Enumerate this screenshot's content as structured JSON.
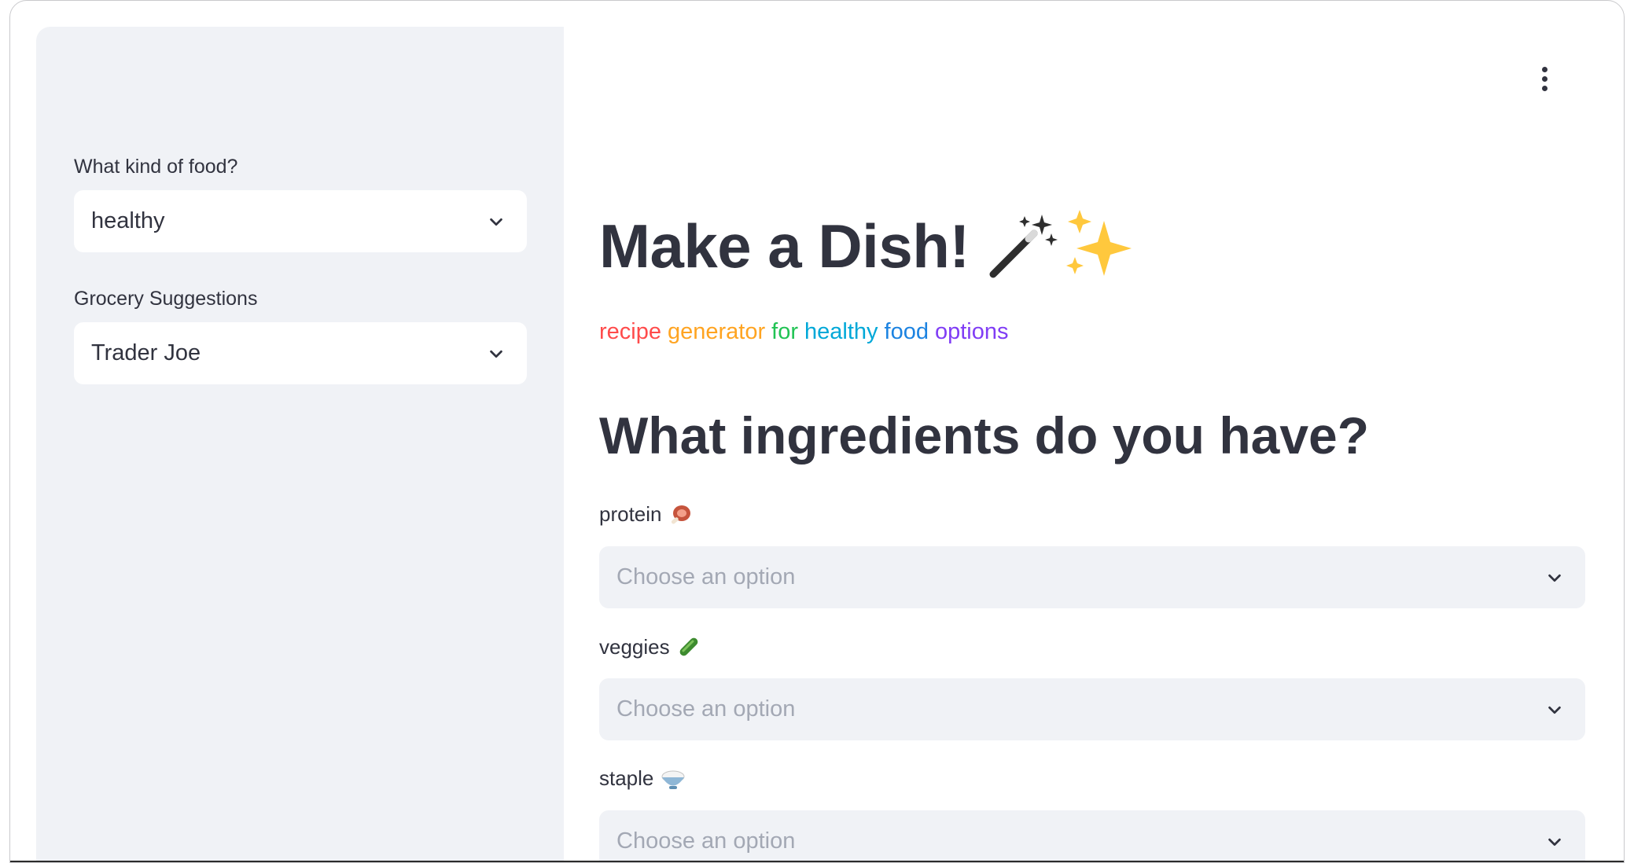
{
  "sidebar": {
    "food_kind": {
      "label": "What kind of food?",
      "value": "healthy"
    },
    "grocery": {
      "label": "Grocery Suggestions",
      "value": "Trader Joe"
    }
  },
  "main": {
    "title": "Make a Dish!",
    "subtitle_words": [
      {
        "text": "recipe",
        "color": "#ff4b4b"
      },
      {
        "text": "generator",
        "color": "#ffa421"
      },
      {
        "text": "for",
        "color": "#21c354"
      },
      {
        "text": "healthy",
        "color": "#00c0f2"
      },
      {
        "text": "food",
        "color": "#1c83e1"
      },
      {
        "text": "options",
        "color": "#803df5"
      }
    ],
    "heading": "What ingredients do you have?",
    "fields": [
      {
        "label": "protein",
        "icon": "meat-icon",
        "placeholder": "Choose an option"
      },
      {
        "label": "veggies",
        "icon": "cucumber-icon",
        "placeholder": "Choose an option"
      },
      {
        "label": "staple",
        "icon": "rice-bowl-icon",
        "placeholder": "Choose an option"
      }
    ]
  },
  "icons": {
    "menu": "vertical-ellipsis-icon",
    "title": [
      "magic-wand-icon",
      "sparkles-icon"
    ]
  }
}
